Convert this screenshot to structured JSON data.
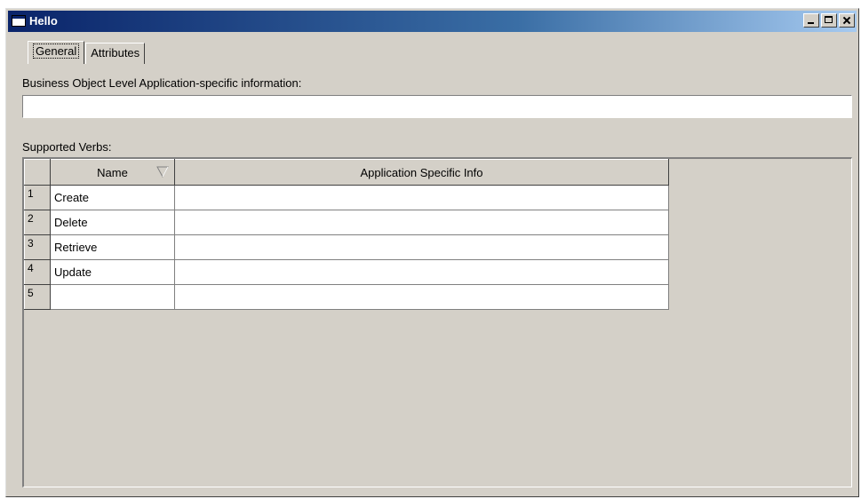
{
  "window": {
    "title": "Hello"
  },
  "tabs": [
    {
      "label": "General",
      "active": true
    },
    {
      "label": "Attributes",
      "active": false
    }
  ],
  "business_object": {
    "label": "Business Object Level Application-specific information:",
    "value": ""
  },
  "verbs": {
    "label": "Supported Verbs:",
    "columns": {
      "name": "Name",
      "info": "Application Specific Info"
    },
    "rows": [
      {
        "num": "1",
        "name": "Create",
        "info": ""
      },
      {
        "num": "2",
        "name": "Delete",
        "info": ""
      },
      {
        "num": "3",
        "name": "Retrieve",
        "info": ""
      },
      {
        "num": "4",
        "name": "Update",
        "info": ""
      },
      {
        "num": "5",
        "name": "",
        "info": ""
      }
    ]
  },
  "icons": {
    "title": "window-icon",
    "minimize": "minimize-icon",
    "maximize": "maximize-icon",
    "close": "close-icon",
    "sort": "sort-triangle-icon"
  },
  "colors": {
    "titlebar_start": "#0a246a",
    "titlebar_end": "#a6caf0",
    "face": "#d4d0c8"
  }
}
